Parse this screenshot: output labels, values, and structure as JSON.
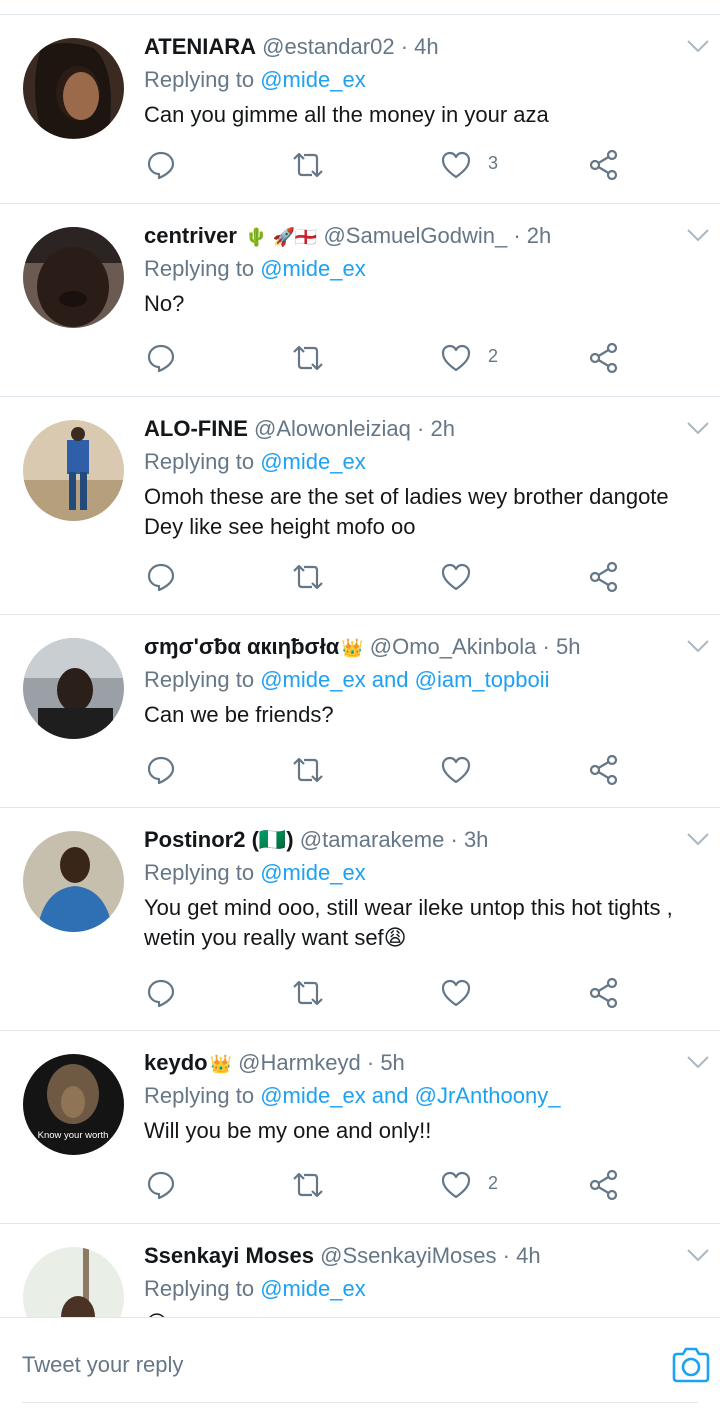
{
  "tweets": [
    {
      "name": "ATENIARA",
      "emoji": "",
      "handle": "@estandar02",
      "dot": "·",
      "time": "4h",
      "reply_prefix": "Replying to",
      "reply_to": "@mide_ex",
      "text": "Can you gimme all the money in your aza",
      "likes": "3"
    },
    {
      "name": "centriver",
      "emoji": "🌵 🚀🏴󠁧󠁢󠁥󠁮󠁧󠁿",
      "handle": "@SamuelGodwin_",
      "dot": "·",
      "time": "2h",
      "reply_prefix": "Replying to",
      "reply_to": "@mide_ex",
      "text": "No?",
      "likes": "2"
    },
    {
      "name": "ALO-FINE",
      "emoji": "",
      "handle": "@Alowonleiziaq",
      "dot": "·",
      "time": "2h",
      "reply_prefix": "Replying to",
      "reply_to": "@mide_ex",
      "text": "Omoh these are the set of ladies wey brother dangote Dey like see height mofo oo",
      "likes": ""
    },
    {
      "name": "σɱσ'σƀα αкιηƀσłα",
      "emoji": "👑",
      "handle": "@Omo_Akinbola",
      "dot": "·",
      "time": "5h",
      "reply_prefix": "Replying to",
      "reply_to": "@mide_ex and @iam_topboii",
      "text": "Can we be friends?",
      "likes": ""
    },
    {
      "name": "Postinor2 (🇳🇬)",
      "emoji": "",
      "handle": "@tamarakeme",
      "dot": "·",
      "time": "3h",
      "reply_prefix": "Replying to",
      "reply_to": "@mide_ex",
      "text": "You get mind ooo, still wear ileke untop this hot tights , wetin you really want sef😩",
      "likes": ""
    },
    {
      "name": "keydo",
      "emoji": "👑",
      "handle": "@Harmkeyd",
      "dot": "·",
      "time": "5h",
      "reply_prefix": "Replying to",
      "reply_to": "@mide_ex and @JrAnthoony_",
      "text": "Will you be my one and only!!",
      "likes": "2",
      "avatar_caption": "Know your worth"
    },
    {
      "name": "Ssenkayi Moses",
      "emoji": "",
      "handle": "@SsenkayiMoses",
      "dot": "·",
      "time": "4h",
      "reply_prefix": "Replying to",
      "reply_to": "@mide_ex",
      "text": "😂",
      "likes": ""
    }
  ],
  "composer": {
    "placeholder": "Tweet your reply"
  },
  "icons": {
    "comment": "comment-icon",
    "retweet": "retweet-icon",
    "like": "heart-icon",
    "share": "share-icon",
    "caret": "chevron-down-icon",
    "camera": "camera-icon"
  },
  "colors": {
    "link": "#1da1f2",
    "muted": "#657786",
    "text": "#14171a",
    "divider": "#e1e8ed"
  }
}
